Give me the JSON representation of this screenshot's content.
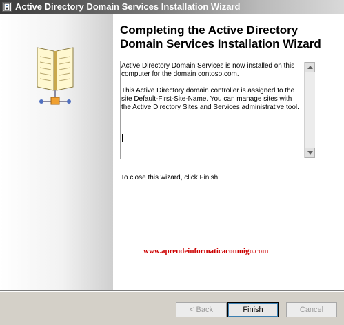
{
  "window": {
    "title": "Active Directory Domain Services Installation Wizard"
  },
  "header": {
    "title": "Completing the Active Directory Domain Services Installation Wizard"
  },
  "info": {
    "paragraphs": [
      "Active Directory Domain Services is now installed on this computer for the domain contoso.com.",
      "This Active Directory domain controller is assigned to the site Default-First-Site-Name. You can manage sites with the Active Directory Sites and Services administrative tool."
    ]
  },
  "close_hint": "To close this wizard, click Finish.",
  "watermark": "www.aprendeinformaticaconmigo.com",
  "buttons": {
    "back": "< Back",
    "finish": "Finish",
    "cancel": "Cancel"
  },
  "icons": {
    "title": "wizard-window-icon",
    "sidebar": "directory-book-icon",
    "scroll_up": "scroll-up-arrow-icon",
    "scroll_down": "scroll-down-arrow-icon"
  },
  "colors": {
    "watermark": "#cc0000",
    "content_bg": "#ffffff",
    "dialog_bg": "#d4d0c8"
  }
}
